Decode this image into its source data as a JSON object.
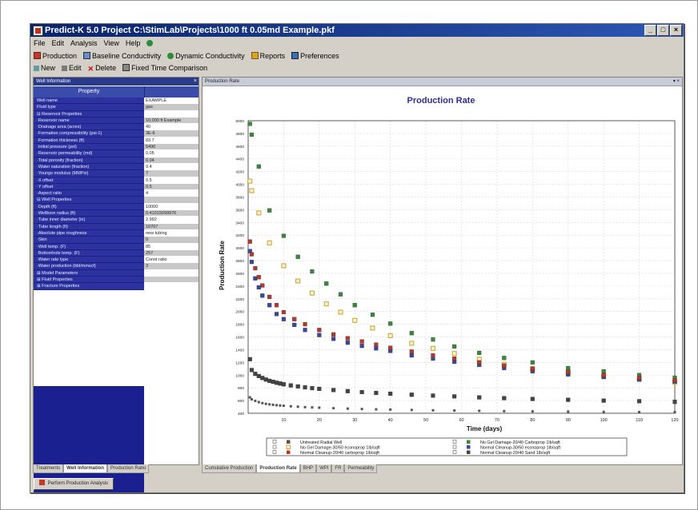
{
  "window": {
    "title": "Predict-K 5.0 Project C:\\StimLab\\Projects\\1000 ft 0.05md Example.pkf",
    "btn_min": "_",
    "btn_max": "□",
    "btn_close": "×"
  },
  "menu": [
    "File",
    "Edit",
    "Analysis",
    "View",
    "Help"
  ],
  "toolbar1": [
    "Production",
    "Baseline Conductivity",
    "Dynamic Conductivity",
    "Reports",
    "Preferences"
  ],
  "toolbar2": [
    "New",
    "Edit",
    "Delete",
    "Fixed Time Comparison"
  ],
  "left_panel": {
    "title": "Well Information",
    "column_header": "Property",
    "tabs": [
      "Treatments",
      "Well Information",
      "Production Ratio"
    ]
  },
  "properties": [
    {
      "k": "Well name",
      "v": "EXAMPLE"
    },
    {
      "k": "Fluid type",
      "v": "gas"
    },
    {
      "k": "⊟ Reservoir Properties",
      "v": ""
    },
    {
      "k": "·Reservoir name",
      "v": "10,000 ft Example"
    },
    {
      "k": "·Drainage area (acres)",
      "v": "40"
    },
    {
      "k": "·Formation compressibility (psi-1)",
      "v": "3E-6"
    },
    {
      "k": "·Formation thickness (ft)",
      "v": "83.7"
    },
    {
      "k": "·Initial pressure (psi)",
      "v": "5490"
    },
    {
      "k": "·Reservoir permeability (md)",
      "v": "0.05"
    },
    {
      "k": "·Total porosity (fraction)",
      "v": "0.04"
    },
    {
      "k": "·Water saturation (fraction)",
      "v": "0.4"
    },
    {
      "k": "·Youngs modulus (MMPsi)",
      "v": "7"
    },
    {
      "k": "·X offset",
      "v": "0.5"
    },
    {
      "k": "·Y offset",
      "v": "0.5"
    },
    {
      "k": "·Aspect ratio",
      "v": "4"
    },
    {
      "k": "⊟ Well Properties",
      "v": ""
    },
    {
      "k": "·Depth (ft)",
      "v": "10000"
    },
    {
      "k": "·Wellbore radius (ft)",
      "v": "0.41015099976"
    },
    {
      "k": "·Tube inner diameter (in)",
      "v": "2.992"
    },
    {
      "k": "·Tube length (ft)",
      "v": "10707"
    },
    {
      "k": "·Absolute pipe roughness",
      "v": "new tubing"
    },
    {
      "k": "·Skin",
      "v": "0"
    },
    {
      "k": "·Well temp. (F)",
      "v": "85"
    },
    {
      "k": "·Bottomhole temp. (F)",
      "v": "257"
    },
    {
      "k": "·Water rate type",
      "v": "Const ratio"
    },
    {
      "k": "·Water production (bbl/mmscf)",
      "v": "3"
    },
    {
      "k": "⊞ Model Parameters",
      "v": ""
    },
    {
      "k": "⊞ Fluid Properties",
      "v": ""
    },
    {
      "k": "⊞ Fracture Properties",
      "v": ""
    }
  ],
  "chart_panel": {
    "title": "Production Rate",
    "tabs": [
      "Cumulative Production",
      "Production Rate",
      "BHP",
      "WPI",
      "FR",
      "Permeability"
    ]
  },
  "status_button": "Perform Production Analysis",
  "chart_data": {
    "type": "scatter",
    "title": "Production Rate",
    "xlabel": "Time (days)",
    "ylabel": "Production Rate",
    "xlim": [
      0,
      120
    ],
    "ylim": [
      400,
      5000
    ],
    "xticks": [
      10,
      20,
      30,
      40,
      50,
      60,
      70,
      80,
      90,
      100,
      110,
      120
    ],
    "yticks": [
      400,
      600,
      800,
      1000,
      1200,
      1400,
      1600,
      1800,
      2000,
      2200,
      2400,
      2600,
      2800,
      3000,
      3200,
      3400,
      3600,
      3800,
      4000,
      4200,
      4400,
      4600,
      4800,
      5000
    ],
    "legend_position": "bottom",
    "series": [
      {
        "name": "Untreated Radial Well",
        "color": "#555555",
        "marker": "small",
        "x": [
          0.5,
          1,
          2,
          3,
          4,
          5,
          6,
          7,
          8,
          9,
          10,
          12,
          14,
          16,
          18,
          20,
          24,
          28,
          32,
          36,
          40,
          46,
          52,
          58,
          65,
          72,
          80,
          90,
          100,
          110,
          120
        ],
        "y": [
          650,
          620,
          595,
          575,
          560,
          548,
          540,
          533,
          527,
          522,
          518,
          510,
          503,
          497,
          492,
          488,
          480,
          473,
          467,
          462,
          458,
          452,
          447,
          443,
          438,
          434,
          430,
          426,
          422,
          419,
          416
        ]
      },
      {
        "name": "No Gel Damage-20/40 Carboprop 1lb/sqft",
        "color": "#3a8a3a",
        "marker": "square",
        "x": [
          0.5,
          1,
          3,
          6,
          10,
          14,
          18,
          22,
          26,
          30,
          35,
          40,
          46,
          52,
          58,
          65,
          72,
          80,
          90,
          100,
          110,
          120
        ],
        "y": [
          4950,
          4780,
          4280,
          3590,
          3190,
          2860,
          2630,
          2440,
          2270,
          2100,
          1950,
          1810,
          1660,
          1560,
          1450,
          1350,
          1270,
          1200,
          1110,
          1060,
          1000,
          960
        ]
      },
      {
        "name": "No Gel Damage-30/50 econoprop 1lb/sqft",
        "color": "#c8a838",
        "marker": "square-open",
        "x": [
          0.5,
          1,
          3,
          6,
          10,
          14,
          18,
          22,
          26,
          30,
          35,
          40,
          46,
          52,
          58,
          65,
          72,
          80,
          90,
          100,
          110,
          120
        ],
        "y": [
          4050,
          3900,
          3550,
          3080,
          2720,
          2480,
          2290,
          2120,
          1990,
          1860,
          1740,
          1620,
          1500,
          1420,
          1340,
          1250,
          1170,
          1100,
          1040,
          980,
          935,
          890
        ]
      },
      {
        "name": "Normal Cleanup-30/50 econoprop 1lb/sqft",
        "color": "#3a4a9a",
        "marker": "square",
        "x": [
          0.5,
          1,
          2,
          3,
          4,
          6,
          8,
          10,
          13,
          16,
          20,
          24,
          28,
          32,
          36,
          40,
          46,
          52,
          58,
          65,
          72,
          80,
          90,
          100,
          110,
          120
        ],
        "y": [
          2950,
          2780,
          2520,
          2380,
          2250,
          2100,
          1960,
          1880,
          1790,
          1710,
          1630,
          1570,
          1510,
          1460,
          1420,
          1380,
          1310,
          1260,
          1210,
          1160,
          1110,
          1060,
          1010,
          970,
          930,
          900
        ]
      },
      {
        "name": "Normal Cleanup-20/40 carboprop 1lb/sqft",
        "color": "#b83830",
        "marker": "square",
        "x": [
          0.5,
          1,
          2,
          3,
          4,
          6,
          8,
          10,
          13,
          16,
          20,
          24,
          28,
          32,
          36,
          40,
          46,
          52,
          58,
          65,
          72,
          80,
          90,
          100,
          110,
          120
        ],
        "y": [
          3100,
          2900,
          2680,
          2540,
          2410,
          2230,
          2100,
          1990,
          1880,
          1800,
          1710,
          1640,
          1580,
          1530,
          1480,
          1430,
          1370,
          1310,
          1260,
          1200,
          1150,
          1100,
          1050,
          1000,
          960,
          920
        ]
      },
      {
        "name": "Normal Cleanup-20/40 Sand 1lb/sqft",
        "color": "#444444",
        "marker": "square",
        "x": [
          0.5,
          1,
          2,
          3,
          4,
          5,
          6,
          7,
          8,
          9,
          10,
          12,
          14,
          16,
          18,
          20,
          24,
          28,
          32,
          36,
          40,
          46,
          52,
          58,
          65,
          72,
          80,
          90,
          100,
          110,
          120
        ],
        "y": [
          1250,
          1080,
          1020,
          985,
          955,
          930,
          910,
          895,
          880,
          868,
          856,
          838,
          822,
          808,
          795,
          784,
          765,
          748,
          733,
          720,
          708,
          692,
          678,
          665,
          650,
          638,
          625,
          612,
          600,
          590,
          580
        ]
      }
    ]
  }
}
